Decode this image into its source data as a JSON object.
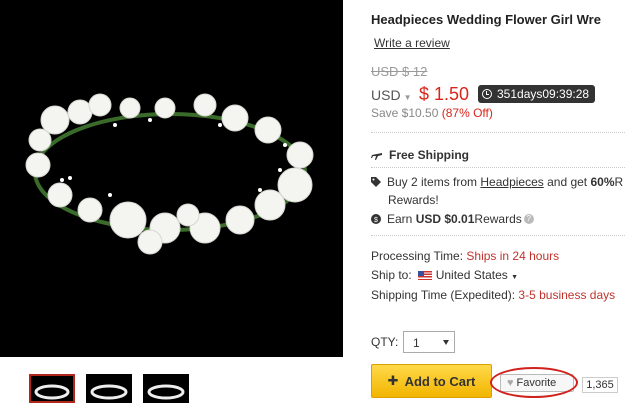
{
  "product": {
    "title": "Headpieces Wedding Flower Girl Wre",
    "review_link": "Write a review",
    "old_price": "USD $ 12",
    "currency": "USD",
    "price": "$ 1.50",
    "countdown": "351days09:39:28",
    "save_text": "Save $10.50",
    "save_pct": "(87% Off)"
  },
  "promo": {
    "free_shipping": "Free Shipping",
    "buy_prefix": "Buy 2 items from ",
    "buy_link": "Headpieces",
    "buy_mid": " and get ",
    "buy_pct": "60%",
    "buy_suffix": " R",
    "rewards_line": "Rewards!",
    "earn_prefix": "Earn ",
    "earn_amount": "USD $0.01",
    "earn_suffix": " Rewards"
  },
  "shipping": {
    "processing_label": "Processing Time: ",
    "processing_value": "Ships in 24 hours",
    "ship_to_label": "Ship to:",
    "ship_to_value": "United States",
    "time_label": "Shipping Time (Expedited): ",
    "time_value": "3-5 business days"
  },
  "purchase": {
    "qty_label": "QTY:",
    "qty_value": "1",
    "add_to_cart": "Add to Cart",
    "favorite": "Favorite",
    "favorite_count": "1,365"
  },
  "icons": {
    "price_color": "#d8261b",
    "cart_button_color": "#f2b500",
    "highlight_circle_color": "#d0211c"
  }
}
